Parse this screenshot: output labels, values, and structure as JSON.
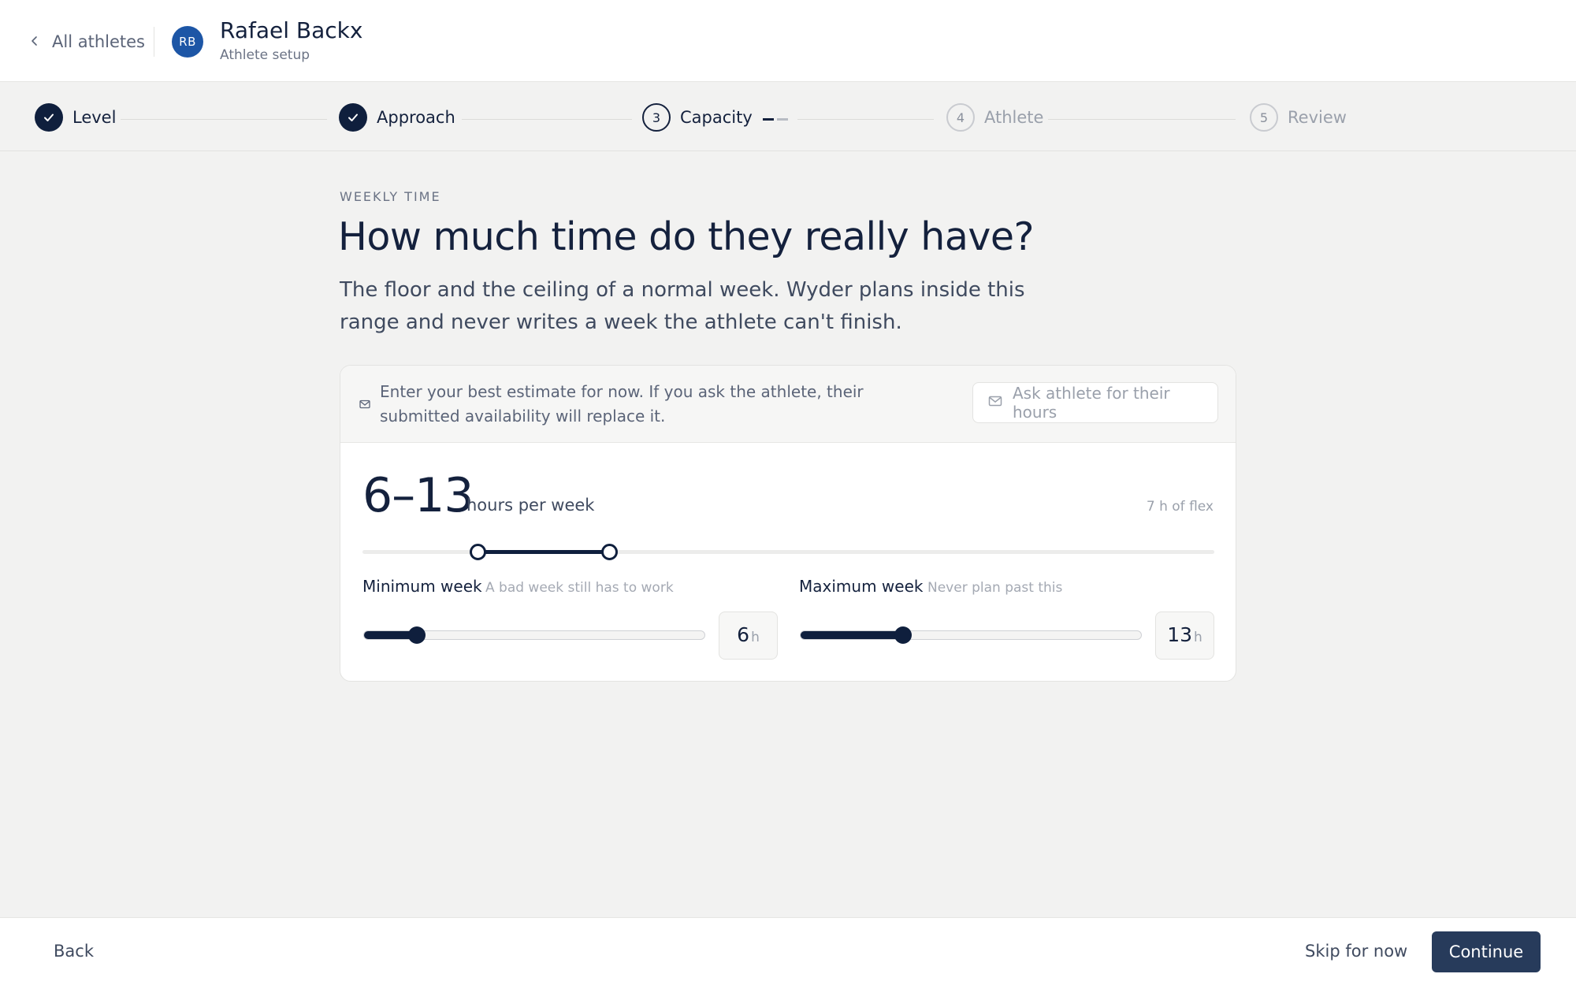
{
  "header": {
    "back_label": "All athletes",
    "avatar_initials": "RB",
    "athlete_name": "Rafael Backx",
    "athlete_subtitle": "Athlete setup"
  },
  "stepper": {
    "steps": [
      {
        "label": "Level",
        "state": "done"
      },
      {
        "label": "Approach",
        "state": "done"
      },
      {
        "label": "Capacity",
        "state": "current",
        "number": "3"
      },
      {
        "label": "Athlete",
        "state": "upcoming",
        "number": "4"
      },
      {
        "label": "Review",
        "state": "upcoming",
        "number": "5"
      }
    ]
  },
  "main": {
    "eyebrow": "WEEKLY TIME",
    "headline": "How much time do they really have?",
    "lede": "The floor and the ceiling of a normal week. Wyder plans inside this range and never writes a week the athlete can't finish."
  },
  "card": {
    "banner_text": "Enter your best estimate for now. If you ask the athlete, their submitted availability will replace it.",
    "ask_button_label": "Ask athlete for their hours",
    "range_value": "6–13",
    "range_unit": "hours per week",
    "flex_note": "7 h of flex",
    "range_min_fraction": 0.135,
    "range_max_fraction": 0.29,
    "min_week": {
      "label": "Minimum week",
      "hint": "A bad week still has to work",
      "value": "6",
      "unit": "h",
      "slider_fraction": 0.155
    },
    "max_week": {
      "label": "Maximum week",
      "hint": "Never plan past this",
      "value": "13",
      "unit": "h",
      "slider_fraction": 0.3
    }
  },
  "footer": {
    "back_label": "Back",
    "skip_label": "Skip for now",
    "continue_label": "Continue"
  },
  "colors": {
    "primary": "#0f1f3d",
    "continue_button": "#273b5b",
    "avatar": "#1d56a6",
    "background": "#f2f2f1"
  },
  "icons": [
    "chevron-left-icon",
    "check-icon",
    "mail-icon"
  ]
}
